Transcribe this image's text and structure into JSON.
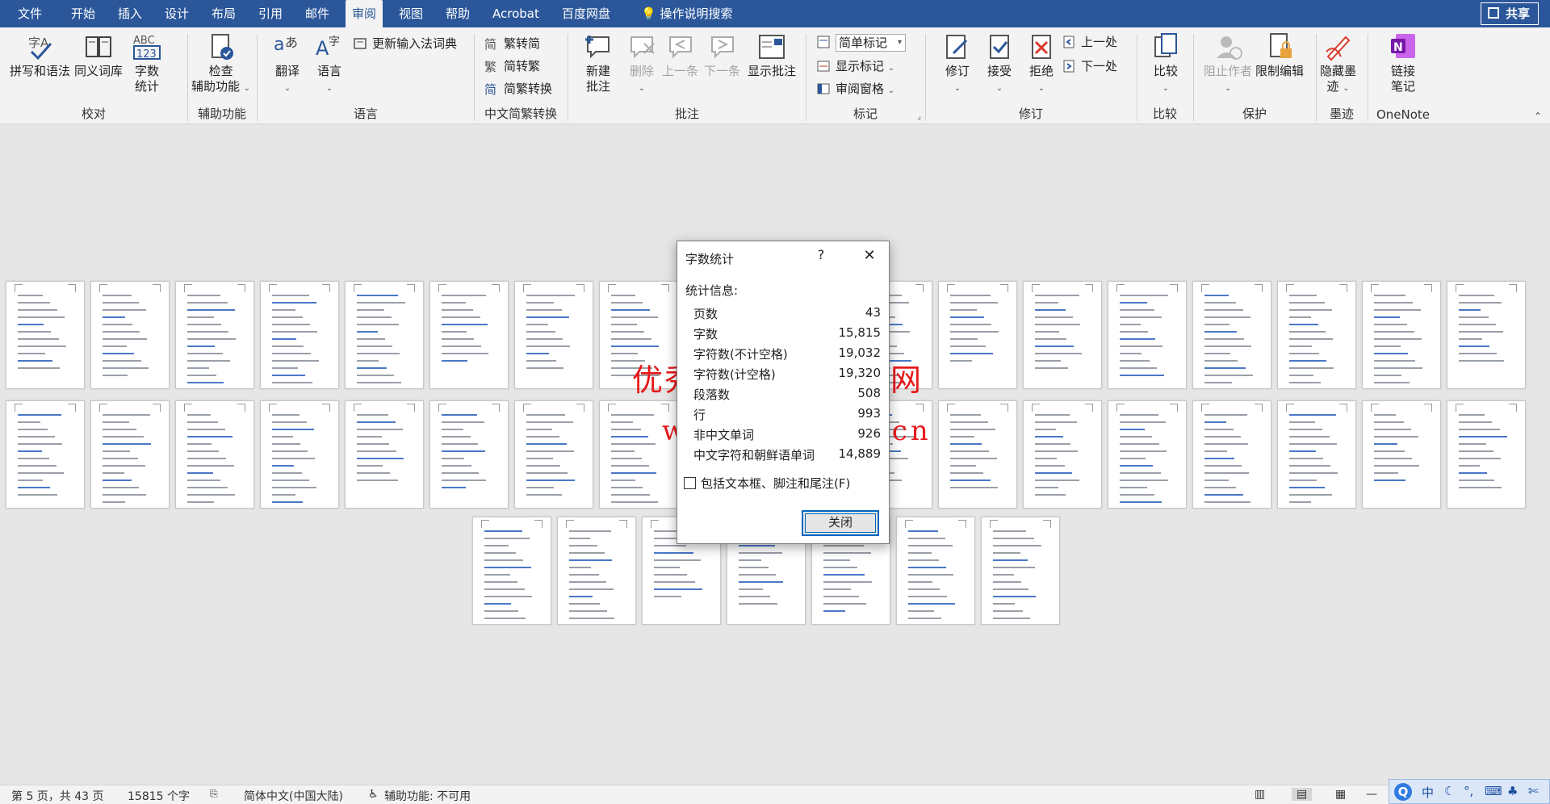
{
  "menubar": {
    "tabs": [
      "文件",
      "开始",
      "插入",
      "设计",
      "布局",
      "引用",
      "邮件",
      "审阅",
      "视图",
      "帮助",
      "Acrobat",
      "百度网盘"
    ],
    "active_tab": "审阅",
    "search_label": "操作说明搜索",
    "share_label": "共享"
  },
  "ribbon": {
    "proofing": {
      "spell": "拼写和语法",
      "thesaurus": "同义词库",
      "wordcount_line1": "字数",
      "wordcount_line2": "统计",
      "label": "校对"
    },
    "accessibility": {
      "check_line1": "检查",
      "check_line2": "辅助功能",
      "label": "辅助功能"
    },
    "language": {
      "translate": "翻译",
      "language": "语言",
      "update_ime": "更新输入法词典",
      "label": "语言"
    },
    "chinese_conv": {
      "t2s": "繁转简",
      "s2t": "简转繁",
      "convert": "简繁转换",
      "label": "中文简繁转换"
    },
    "comments": {
      "new_line1": "新建",
      "new_line2": "批注",
      "delete": "删除",
      "prev": "上一条",
      "next": "下一条",
      "show": "显示批注",
      "label": "批注"
    },
    "tracking": {
      "markup_select": "简单标记",
      "show_markup": "显示标记",
      "review_pane": "审阅窗格",
      "label": "标记"
    },
    "changes": {
      "track": "修订",
      "accept": "接受",
      "reject": "拒绝",
      "prev": "上一处",
      "next": "下一处",
      "label": "修订"
    },
    "compare": {
      "compare": "比较",
      "label": "比较"
    },
    "protect": {
      "block": "阻止作者",
      "restrict": "限制编辑",
      "label": "保护"
    },
    "ink": {
      "hide_line1": "隐藏墨",
      "hide_line2": "迹",
      "label": "墨迹"
    },
    "onenote": {
      "link_line1": "链接",
      "link_line2": "笔记",
      "label": "OneNote"
    }
  },
  "dialog": {
    "title": "字数统计",
    "help": "?",
    "subtitle": "统计信息:",
    "stats": [
      {
        "label": "页数",
        "value": "43"
      },
      {
        "label": "字数",
        "value": "15,815"
      },
      {
        "label": "字符数(不计空格)",
        "value": "19,032"
      },
      {
        "label": "字符数(计空格)",
        "value": "19,320"
      },
      {
        "label": "段落数",
        "value": "508"
      },
      {
        "label": "行",
        "value": "993"
      },
      {
        "label": "非中文单词",
        "value": "926"
      },
      {
        "label": "中文字符和朝鲜语单词",
        "value": "14,889"
      }
    ],
    "checkbox_label": "包括文本框、脚注和尾注(F)",
    "checkbox_checked": false,
    "close_button": "关闭"
  },
  "watermark": {
    "line1": "优秀毕业设计资源网",
    "line2": "www.keyicad.cn"
  },
  "statusbar": {
    "page": "第 5 页，共 43 页",
    "words": "15815 个字",
    "language": "简体中文(中国大陆)",
    "accessibility": "辅助功能: 不可用",
    "zoom_minus": "—"
  },
  "ime": {
    "lang": "中"
  },
  "colors": {
    "title_bar": "#2b579a",
    "ribbon": "#f3f3f3",
    "canvas": "#e6e6e6",
    "watermark": "#e8191b",
    "button_focus": "#0067c0"
  }
}
